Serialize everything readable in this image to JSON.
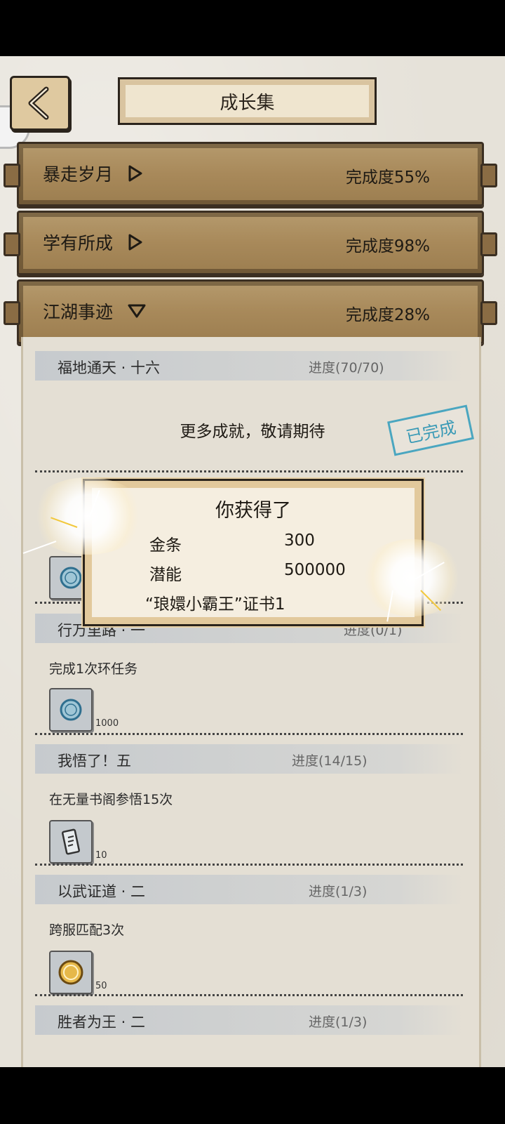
{
  "header": {
    "title": "成长集"
  },
  "categories": [
    {
      "label": "暴走岁月",
      "completion": "完成度55%",
      "expanded": false
    },
    {
      "label": "学有所成",
      "completion": "完成度98%",
      "expanded": false
    },
    {
      "label": "江湖事迹",
      "completion": "完成度28%",
      "expanded": true
    }
  ],
  "achievements": [
    {
      "name": "福地通天 · 十六",
      "progress": "进度(70/70)"
    },
    {
      "name": "行万里路 · 一",
      "progress": "进度(0/1)",
      "desc": "完成1次环任务",
      "reward_count": "1000"
    },
    {
      "name": "我悟了！五",
      "progress": "进度(14/15)",
      "desc": "在无量书阁参悟15次",
      "reward_count": "10"
    },
    {
      "name": "以武证道 · 二",
      "progress": "进度(1/3)",
      "desc": "跨服匹配3次",
      "reward_count": "50"
    },
    {
      "name": "胜者为王 · 二",
      "progress": "进度(1/3)"
    }
  ],
  "more_text": "更多成就，敬请期待",
  "stamp_text": "已完成",
  "popup": {
    "title": "你获得了",
    "rows": [
      {
        "item": "金条",
        "amount": "300"
      },
      {
        "item": "潜能",
        "amount": "500000"
      }
    ],
    "extra": "“琅嬛小霸王”证书1"
  },
  "icons": {
    "back": "chevron-left-icon",
    "collapsed": "triangle-right-icon",
    "expanded": "triangle-down-icon",
    "coin": "silver-coin-icon",
    "ticket": "ticket-icon",
    "gold": "gold-coin-icon"
  },
  "colors": {
    "bar": "#a8895a",
    "paper": "#e6e2d9",
    "stamp": "#3a9ab6"
  }
}
